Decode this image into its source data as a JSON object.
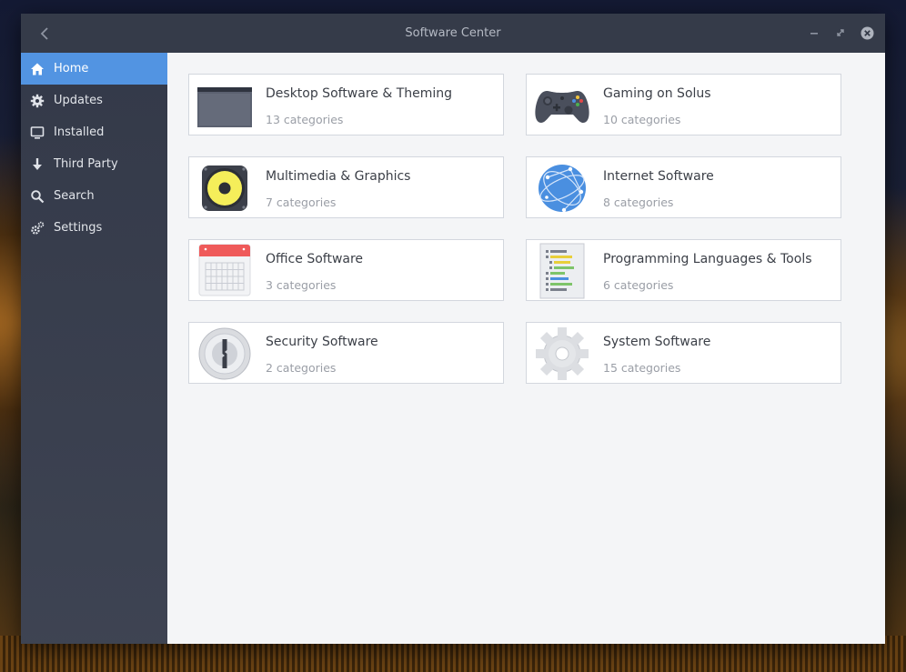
{
  "window": {
    "title": "Software Center"
  },
  "sidebar": {
    "items": [
      {
        "label": "Home",
        "icon": "home-icon",
        "active": true
      },
      {
        "label": "Updates",
        "icon": "gear-badge-icon",
        "active": false
      },
      {
        "label": "Installed",
        "icon": "monitor-icon",
        "active": false
      },
      {
        "label": "Third Party",
        "icon": "download-arrow-icon",
        "active": false
      },
      {
        "label": "Search",
        "icon": "search-icon",
        "active": false
      },
      {
        "label": "Settings",
        "icon": "settings-gears-icon",
        "active": false
      }
    ]
  },
  "categories": [
    {
      "title": "Desktop Software & Theming",
      "subtitle": "13 categories",
      "icon": "desktop-window-icon"
    },
    {
      "title": "Gaming on Solus",
      "subtitle": "10 categories",
      "icon": "gamepad-icon"
    },
    {
      "title": "Multimedia & Graphics",
      "subtitle": "7 categories",
      "icon": "speaker-icon"
    },
    {
      "title": "Internet Software",
      "subtitle": "8 categories",
      "icon": "globe-network-icon"
    },
    {
      "title": "Office Software",
      "subtitle": "3 categories",
      "icon": "calendar-icon"
    },
    {
      "title": "Programming Languages & Tools",
      "subtitle": "6 categories",
      "icon": "code-document-icon"
    },
    {
      "title": "Security Software",
      "subtitle": "2 categories",
      "icon": "keyhole-lock-icon"
    },
    {
      "title": "System Software",
      "subtitle": "15 categories",
      "icon": "system-gear-icon"
    }
  ],
  "colors": {
    "accent": "#5294e2",
    "titlebar": "#353b49",
    "sidebar": "#2f3544",
    "content_bg": "#f4f5f7"
  }
}
